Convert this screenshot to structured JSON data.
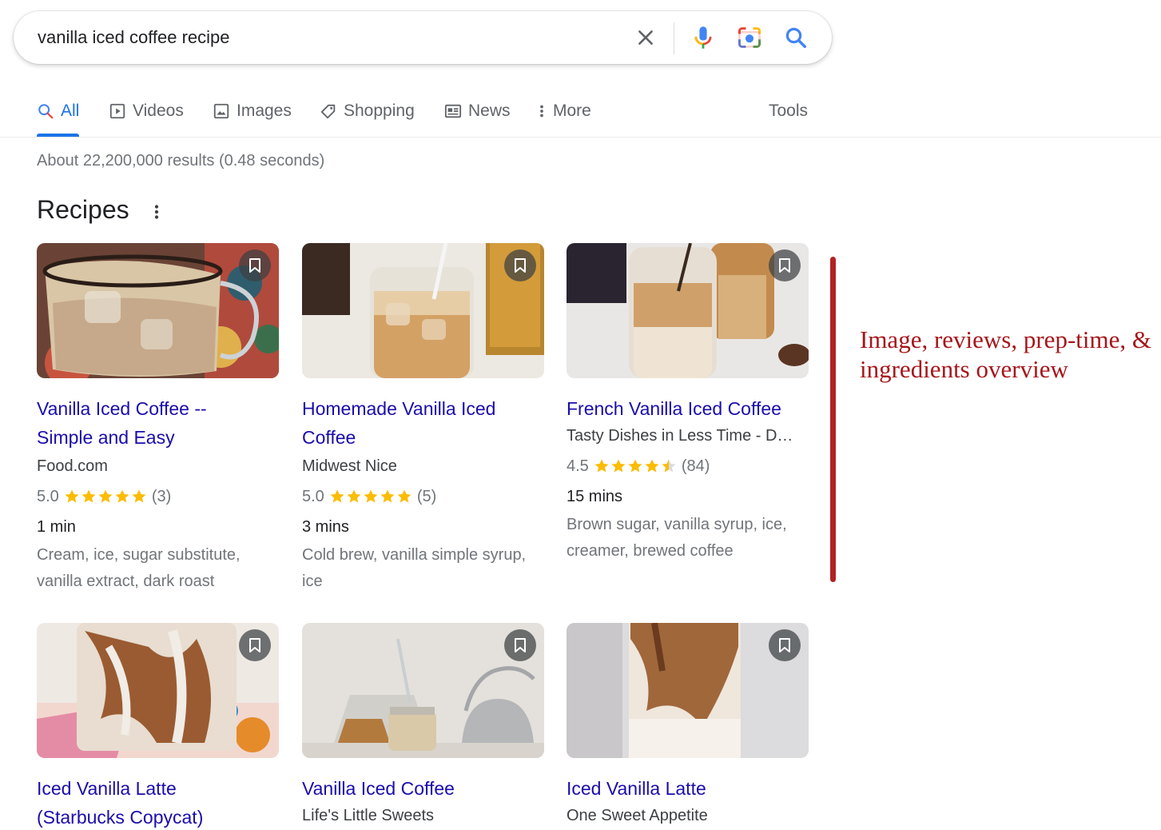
{
  "search": {
    "query": "vanilla iced coffee recipe",
    "icons": [
      "close-icon",
      "microphone-icon",
      "camera-lens-icon",
      "search-icon"
    ]
  },
  "tabs": [
    {
      "label": "All",
      "icon": "search-icon",
      "active": true
    },
    {
      "label": "Videos",
      "icon": "play-icon"
    },
    {
      "label": "Images",
      "icon": "image-icon"
    },
    {
      "label": "Shopping",
      "icon": "tag-icon"
    },
    {
      "label": "News",
      "icon": "newspaper-icon"
    },
    {
      "label": "More",
      "icon": "more-vert-icon"
    },
    {
      "label": "Tools"
    }
  ],
  "stats": "About 22,200,000 results (0.48 seconds)",
  "section": {
    "title": "Recipes"
  },
  "recipes": [
    {
      "title_line1": "Vanilla Iced Coffee --",
      "title_line2": "Simple and Easy",
      "source": "Food.com",
      "rating": "5.0",
      "stars": 5.0,
      "reviews": "(3)",
      "time": "1 min",
      "ingredients_line1": "Cream, ice, sugar substitute,",
      "ingredients_line2": "vanilla extract, dark roast"
    },
    {
      "title_line1": "Homemade Vanilla Iced",
      "title_line2": "Coffee",
      "source": "Midwest Nice",
      "rating": "5.0",
      "stars": 5.0,
      "reviews": "(5)",
      "time": "3 mins",
      "ingredients_line1": "Cold brew, vanilla simple syrup,",
      "ingredients_line2": "ice"
    },
    {
      "title_line1": "French Vanilla Iced Coffee",
      "title_line2": "",
      "source": "Tasty Dishes in Less Time - D…",
      "rating": "4.5",
      "stars": 4.5,
      "reviews": "(84)",
      "time": "15 mins",
      "ingredients_line1": "Brown sugar, vanilla syrup, ice,",
      "ingredients_line2": "creamer, brewed coffee"
    },
    {
      "title_line1": "Iced Vanilla Latte",
      "title_line2": "(Starbucks Copycat)",
      "source": ""
    },
    {
      "title_line1": "Vanilla Iced Coffee",
      "title_line2": "",
      "source": "Life's Little Sweets"
    },
    {
      "title_line1": "Iced Vanilla Latte",
      "title_line2": "",
      "source": "One Sweet Appetite"
    }
  ],
  "annotation": {
    "text": "Image, reviews, prep-time, & ingredients overview"
  },
  "colors": {
    "link": "#1a0dab",
    "accent": "#1a73e8",
    "star": "#fbbc04",
    "annotation": "#a6161b"
  }
}
